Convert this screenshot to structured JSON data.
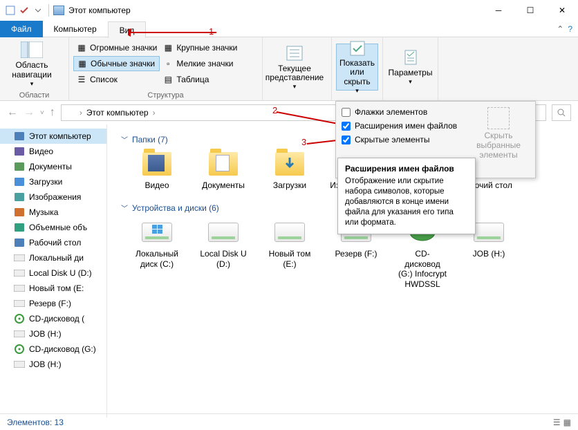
{
  "window": {
    "title": "Этот компьютер"
  },
  "tabs": {
    "file": "Файл",
    "computer": "Компьютер",
    "view": "Вид"
  },
  "ribbon": {
    "nav": {
      "label": "Область навигации",
      "group": "Области"
    },
    "views": {
      "huge": "Огромные значки",
      "large": "Крупные значки",
      "normal": "Обычные значки",
      "small": "Мелкие значки",
      "list": "Список",
      "table": "Таблица",
      "group": "Структура"
    },
    "currentview": "Текущее представление",
    "showhide": "Показать или скрыть",
    "params": "Параметры"
  },
  "dropdown": {
    "flags": "Флажки элементов",
    "ext": "Расширения имен файлов",
    "hidden": "Скрытые элементы",
    "hide_sel": "Скрыть выбранные элементы",
    "footer": "Показать или скрыть"
  },
  "tooltip": {
    "title": "Расширения имен файлов",
    "body": "Отображение или скрытие набора символов, которые добавляются в конце имени файла для указания его типа или формата."
  },
  "tree": [
    {
      "label": "Этот компьютер",
      "icon": "pc",
      "sel": true
    },
    {
      "label": "Видео",
      "icon": "video"
    },
    {
      "label": "Документы",
      "icon": "doc"
    },
    {
      "label": "Загрузки",
      "icon": "down"
    },
    {
      "label": "Изображения",
      "icon": "img"
    },
    {
      "label": "Музыка",
      "icon": "music"
    },
    {
      "label": "Объемные объ",
      "icon": "3d"
    },
    {
      "label": "Рабочий стол",
      "icon": "desk"
    },
    {
      "label": "Локальный ди",
      "icon": "drive"
    },
    {
      "label": "Local Disk U (D:)",
      "icon": "drive"
    },
    {
      "label": "Новый том (E:",
      "icon": "drive"
    },
    {
      "label": "Резерв (F:)",
      "icon": "drive"
    },
    {
      "label": "CD-дисковод (",
      "icon": "cd"
    },
    {
      "label": "JOB (H:)",
      "icon": "drive"
    },
    {
      "label": "CD-дисковод (G:)",
      "icon": "cd"
    },
    {
      "label": "JOB (H:)",
      "icon": "drive"
    }
  ],
  "groups": {
    "folders": {
      "title": "Папки (7)",
      "items": [
        {
          "label": "Видео",
          "icon": "folder-media"
        },
        {
          "label": "Документы",
          "icon": "folder-doc"
        },
        {
          "label": "Загрузки",
          "icon": "folder-dl"
        },
        {
          "label": "Изображения",
          "icon": "folder"
        },
        {
          "label": "",
          "icon": "folder"
        },
        {
          "label": "абочий стол",
          "icon": "desk"
        }
      ]
    },
    "drives": {
      "title": "Устройства и диски (6)",
      "items": [
        {
          "label": "Локальный диск (C:)",
          "icon": "drive-win"
        },
        {
          "label": "Local Disk U (D:)",
          "icon": "drive"
        },
        {
          "label": "Новый том (E:)",
          "icon": "drive"
        },
        {
          "label": "Резерв (F:)",
          "icon": "drive"
        },
        {
          "label": "CD-дисковод (G:) Infocrypt HWDSSL",
          "icon": "cd"
        },
        {
          "label": "JOB (H:)",
          "icon": "drive"
        }
      ]
    }
  },
  "status": {
    "count": "Элементов: 13"
  },
  "annotations": {
    "n1": "1",
    "n2": "2",
    "n3": "3"
  },
  "path": "Этот компьютер"
}
